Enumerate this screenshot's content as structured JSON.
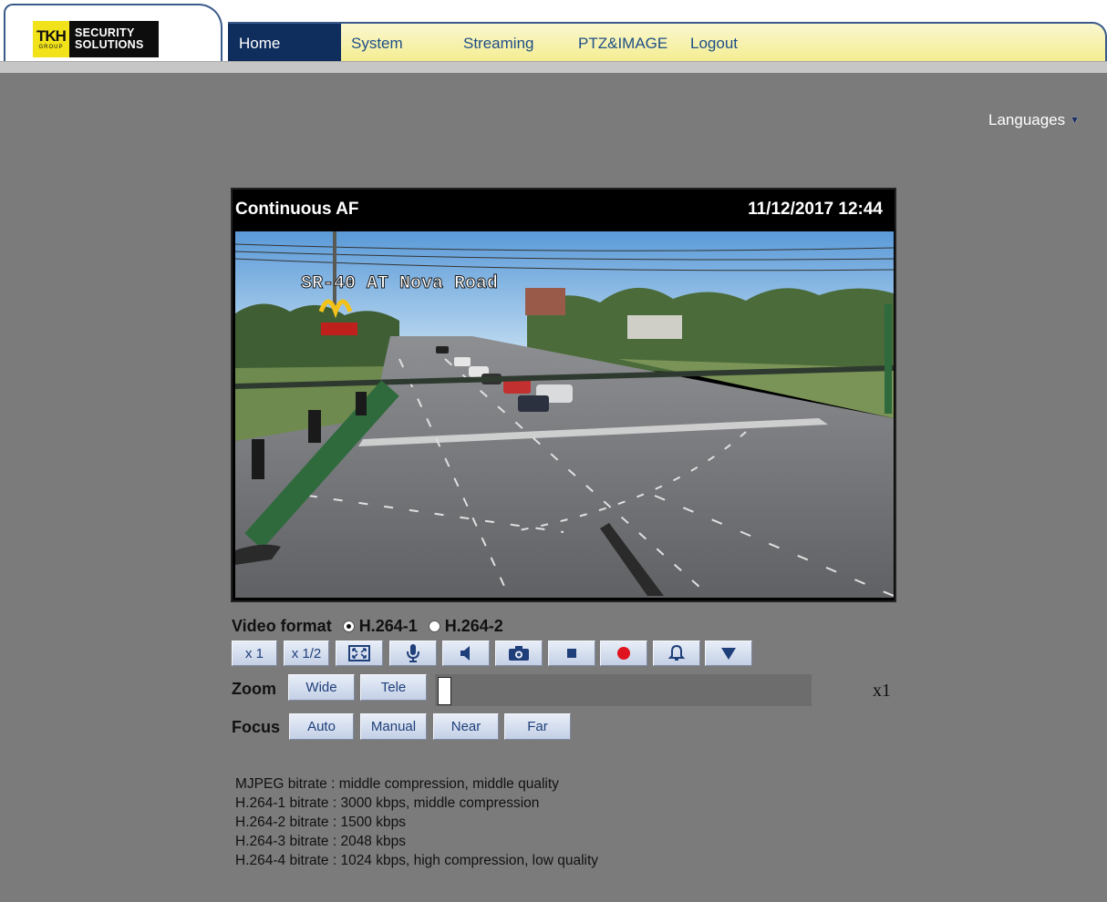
{
  "brand": {
    "mark_letters": "TKH",
    "mark_sub": "GROUP",
    "line1": "SECURITY",
    "line2": "SOLUTIONS",
    "colors": {
      "mark": "#f2e21a",
      "dark": "#0d0d0d"
    }
  },
  "nav": {
    "active": "Home",
    "items": [
      {
        "label": "Home"
      },
      {
        "label": "System"
      },
      {
        "label": "Streaming"
      },
      {
        "label": "PTZ&IMAGE"
      },
      {
        "label": "Logout"
      }
    ]
  },
  "languages": {
    "label": "Languages",
    "icon": "triangle-down-icon"
  },
  "video": {
    "title": "Continuous AF",
    "timestamp": "11/12/2017 12:44",
    "overlay_text": "SR-40 AT Nova Road"
  },
  "video_format": {
    "label": "Video format",
    "options": [
      "H.264-1",
      "H.264-2"
    ],
    "selected": "H.264-1"
  },
  "toolbar": {
    "x1_label": "x 1",
    "x_half_label": "x 1/2",
    "icons": [
      "fullscreen-icon",
      "microphone-icon",
      "speaker-icon",
      "camera-icon",
      "stop-icon",
      "record-icon",
      "alarm-bell-icon",
      "dropdown-triangle-icon"
    ]
  },
  "zoom": {
    "label": "Zoom",
    "wide_label": "Wide",
    "tele_label": "Tele",
    "value": "x1",
    "level_fraction": 0
  },
  "focus": {
    "label": "Focus",
    "buttons": [
      "Auto",
      "Manual",
      "Near",
      "Far"
    ]
  },
  "bitrates": [
    "MJPEG bitrate : middle compression, middle quality",
    "H.264-1 bitrate : 3000 kbps, middle compression",
    "H.264-2 bitrate : 1500 kbps",
    "H.264-3 bitrate : 2048 kbps",
    "H.264-4 bitrate : 1024 kbps, high compression, low quality"
  ],
  "colors": {
    "background": "#7b7b7b",
    "nav_active": "#0f2e5e",
    "nav_text": "#1f4f86",
    "button_text": "#1f3f7a",
    "record": "#e0141e"
  }
}
